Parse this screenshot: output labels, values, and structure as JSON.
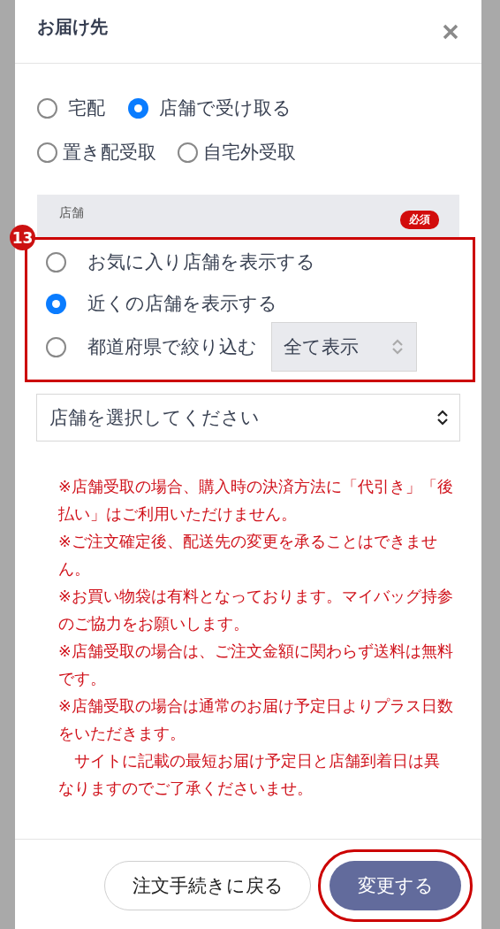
{
  "dialog": {
    "title": "お届け先"
  },
  "delivery_options": [
    {
      "label": "宅配",
      "selected": false
    },
    {
      "label": "店舗で受け取る",
      "selected": true
    },
    {
      "label": "置き配受取",
      "selected": false
    },
    {
      "label": "自宅外受取",
      "selected": false
    }
  ],
  "store_section": {
    "label": "店舗",
    "required_badge": "必須",
    "annotation_number": "13",
    "filter_options": [
      {
        "kind": "plain",
        "label": "お気に入り店舗を表示する",
        "selected": false
      },
      {
        "kind": "plain",
        "label": "近くの店舗を表示する",
        "selected": true
      },
      {
        "kind": "with_select",
        "label": "都道府県で絞り込む",
        "selected": false,
        "select_value": "全て表示"
      }
    ]
  },
  "store_select": {
    "placeholder": "店舗を選択してください"
  },
  "notes": [
    "※店舗受取の場合、購入時の決済方法に「代引き」「後払い」はご利用いただけません。",
    "※ご注文確定後、配送先の変更を承ることはできません。",
    "※お買い物袋は有料となっております。マイバッグ持参のご協力をお願いします。",
    "※店舗受取の場合は、ご注文金額に関わらず送料は無料です。",
    "※店舗受取の場合は通常のお届け予定日よりプラス日数をいただきます。",
    "　サイトに記載の最短お届け予定日と店舗到着日は異なりますのでご了承くださいませ。"
  ],
  "buttons": [
    {
      "kind": "secondary",
      "label": "注文手続きに戻る",
      "highlighted": false
    },
    {
      "kind": "primary",
      "label": "変更する",
      "highlighted": true
    }
  ]
}
